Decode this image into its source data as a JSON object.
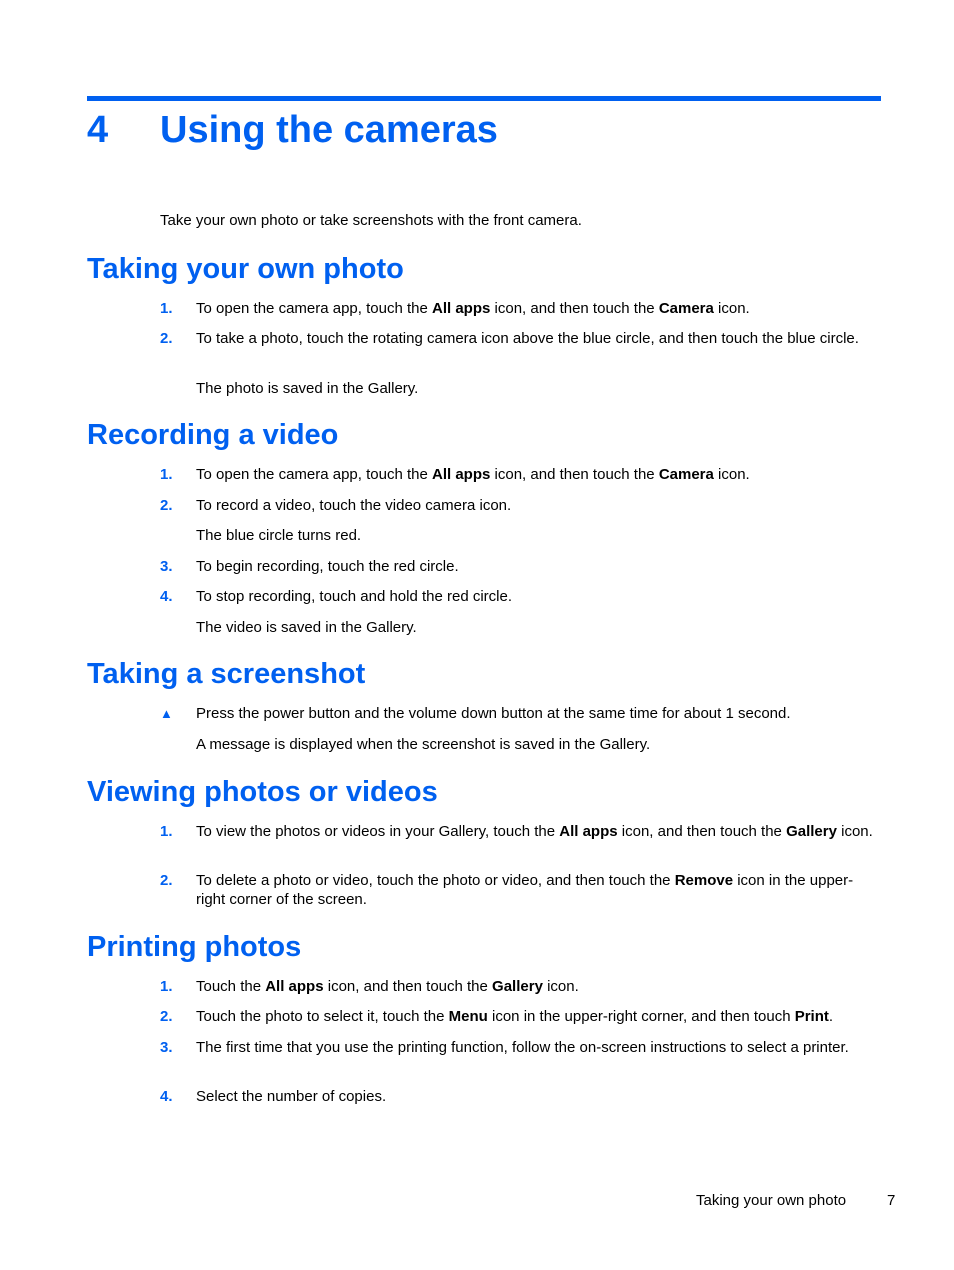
{
  "chapter": {
    "number": "4",
    "title": "Using the cameras"
  },
  "intro": "Take your own photo or take screenshots with the front camera.",
  "sections": [
    {
      "heading": "Taking your own photo",
      "steps": [
        {
          "n": "1.",
          "parts": [
            "To open the camera app, touch the ",
            "All apps",
            " icon, and then touch the ",
            "Camera",
            " icon."
          ]
        },
        {
          "n": "2.",
          "text": "To take a photo, touch the rotating camera icon above the blue circle, and then touch the blue circle."
        }
      ],
      "note": "The photo is saved in the Gallery."
    },
    {
      "heading": "Recording a video",
      "steps": [
        {
          "n": "1.",
          "parts": [
            "To open the camera app, touch the ",
            "All apps",
            " icon, and then touch the ",
            "Camera",
            " icon."
          ]
        },
        {
          "n": "2.",
          "text": "To record a video, touch the video camera icon."
        },
        {
          "n": "3.",
          "text": "To begin recording, touch the red circle."
        },
        {
          "n": "4.",
          "text": "To stop recording, touch and hold the red circle."
        }
      ],
      "note_after_2": "The blue circle turns red.",
      "note": "The video is saved in the Gallery."
    },
    {
      "heading": "Taking a screenshot",
      "bullet_icon": "▲",
      "step": "Press the power button and the volume down button at the same time for about 1 second.",
      "note": "A message is displayed when the screenshot is saved in the Gallery."
    },
    {
      "heading": "Viewing photos or videos",
      "steps": [
        {
          "n": "1.",
          "parts": [
            "To view the photos or videos in your Gallery, touch the ",
            "All apps",
            " icon, and then touch the ",
            "Gallery",
            " icon."
          ]
        },
        {
          "n": "2.",
          "parts": [
            "To delete a photo or video, touch the photo or video, and then touch the ",
            "Remove",
            " icon in the upper-right corner of the screen."
          ]
        }
      ]
    },
    {
      "heading": "Printing photos",
      "steps": [
        {
          "n": "1.",
          "parts": [
            "Touch the ",
            "All apps",
            " icon, and then touch the ",
            "Gallery",
            " icon."
          ]
        },
        {
          "n": "2.",
          "parts": [
            "Touch the photo to select it, touch the ",
            "Menu",
            " icon in the upper-right corner, and then touch ",
            "Print",
            "."
          ]
        },
        {
          "n": "3.",
          "text": "The first time that you use the printing function, follow the on-screen instructions to select a printer."
        },
        {
          "n": "4.",
          "text": "Select the number of copies."
        }
      ]
    }
  ],
  "footer": {
    "section": "Taking your own photo",
    "page": "7"
  }
}
